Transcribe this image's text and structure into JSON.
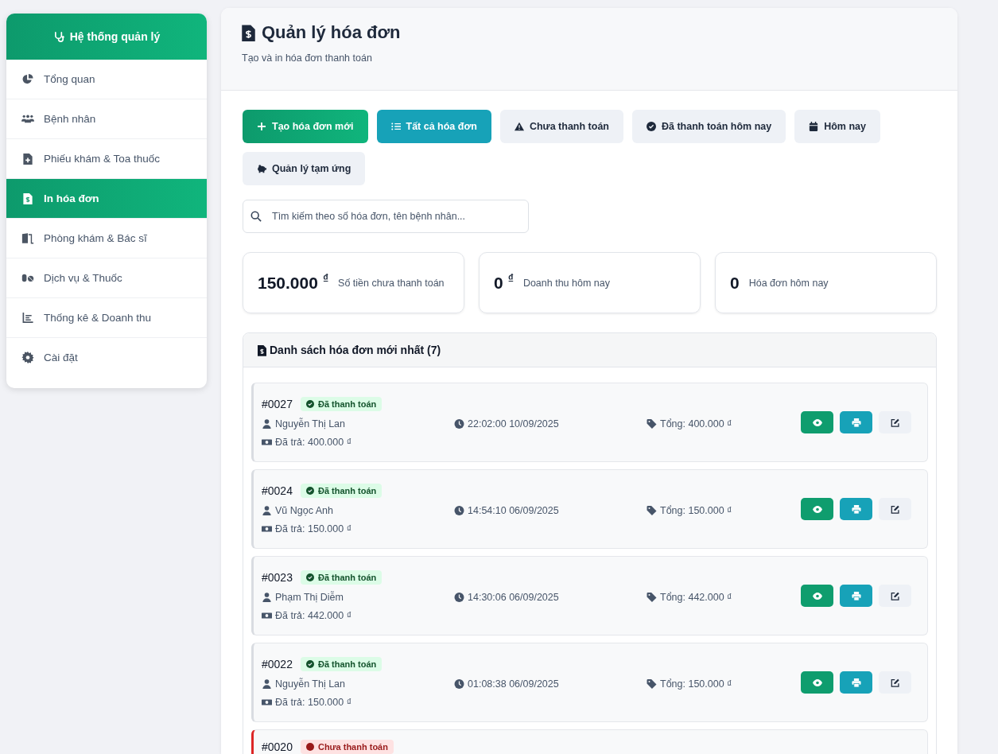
{
  "sidebar": {
    "title": "Hệ thống quản lý",
    "items": [
      {
        "label": "Tổng quan",
        "selected": false
      },
      {
        "label": "Bệnh nhân",
        "selected": false
      },
      {
        "label": "Phiếu khám & Toa thuốc",
        "selected": false
      },
      {
        "label": "In hóa đơn",
        "selected": true
      },
      {
        "label": "Phòng khám & Bác sĩ",
        "selected": false
      },
      {
        "label": "Dịch vụ & Thuốc",
        "selected": false
      },
      {
        "label": "Thống kê & Doanh thu",
        "selected": false
      },
      {
        "label": "Cài đặt",
        "selected": false
      }
    ]
  },
  "page": {
    "title": "Quản lý hóa đơn",
    "subtitle": "Tạo và in hóa đơn thanh toán"
  },
  "create_button": {
    "label": "Tạo hóa đơn mới"
  },
  "filters": [
    {
      "label": "Tất cả hóa đơn",
      "selected": true
    },
    {
      "label": "Chưa thanh toán",
      "selected": false
    },
    {
      "label": "Đã thanh toán hôm nay",
      "selected": false
    },
    {
      "label": "Hôm nay",
      "selected": false
    },
    {
      "label": "Quản lý tạm ứng",
      "selected": false
    }
  ],
  "search": {
    "placeholder": "Tìm kiếm theo số hóa đơn, tên bệnh nhân..."
  },
  "stats": [
    {
      "value": "150.000",
      "unit": "₫",
      "label": "Số tiền chưa thanh toán"
    },
    {
      "value": "0",
      "unit": "₫",
      "label": "Doanh thu hôm nay"
    },
    {
      "value": "0",
      "label": "Hóa đơn hôm nay"
    }
  ],
  "invoice_list": {
    "title": "Danh sách hóa đơn mới nhất (7)",
    "invoices": [
      {
        "number": "#0027",
        "status": {
          "label": "Đã thanh toán",
          "kind": "paid"
        },
        "patient": "Nguyễn Thị Lan",
        "time": "22:02:00 10/09/2025",
        "total": "Tổng: 400.000 ₫",
        "paid": "Đã trả: 400.000 ₫"
      },
      {
        "number": "#0024",
        "status": {
          "label": "Đã thanh toán",
          "kind": "paid"
        },
        "patient": "Vũ Ngọc Anh",
        "time": "14:54:10 06/09/2025",
        "total": "Tổng: 150.000 ₫",
        "paid": "Đã trả: 150.000 ₫"
      },
      {
        "number": "#0023",
        "status": {
          "label": "Đã thanh toán",
          "kind": "paid"
        },
        "patient": "Phạm Thị Diễm",
        "time": "14:30:06 06/09/2025",
        "total": "Tổng: 442.000 ₫",
        "paid": "Đã trả: 442.000 ₫"
      },
      {
        "number": "#0022",
        "status": {
          "label": "Đã thanh toán",
          "kind": "paid"
        },
        "patient": "Nguyễn Thị Lan",
        "time": "01:08:38 06/09/2025",
        "total": "Tổng: 150.000 ₫",
        "paid": "Đã trả: 150.000 ₫"
      },
      {
        "number": "#0020",
        "status": {
          "label": "Chưa thanh toán",
          "kind": "unpaid"
        }
      }
    ]
  }
}
